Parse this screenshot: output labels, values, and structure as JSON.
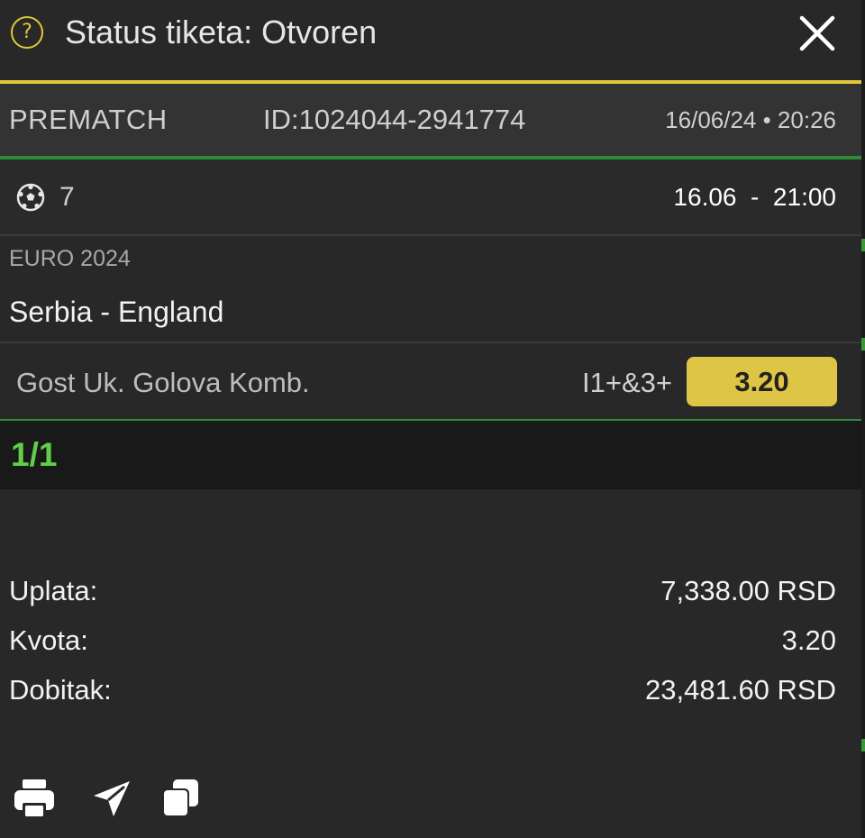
{
  "header": {
    "status_icon_glyph": "?",
    "title": "Status tiketa: Otvoren",
    "close_icon": "close-icon",
    "accent_color": "#e1c73b"
  },
  "ticket": {
    "type": "PREMATCH",
    "id": "ID:1024044-2941774",
    "date": "16/06/24 • 20:26"
  },
  "event": {
    "sport_icon": "soccer-ball-icon",
    "count": "7",
    "time": "16.06  -  21:00",
    "league": "EURO 2024",
    "match": "Serbia - England"
  },
  "bet": {
    "market": "Gost Uk. Golova Komb.",
    "pick": "I1+&3+",
    "odd": "3.20",
    "odd_color": "#dfc545"
  },
  "combination": "1/1",
  "summary": {
    "stake_label": "Uplata:",
    "stake_value": "7,338.00 RSD",
    "odds_label": "Kvota:",
    "odds_value": "3.20",
    "win_label": "Dobitak:",
    "win_value": "23,481.60 RSD"
  },
  "toolbar": {
    "icons": [
      "printer-icon",
      "send-icon",
      "copy-icon"
    ]
  }
}
